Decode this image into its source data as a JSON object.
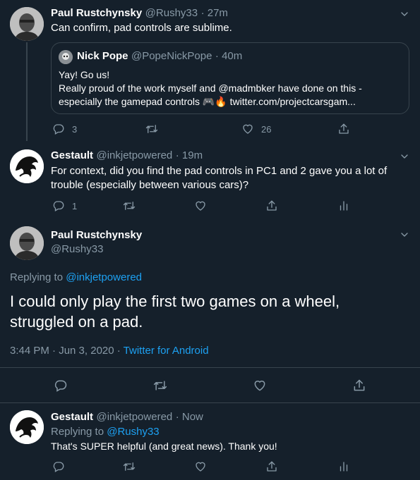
{
  "tweet1": {
    "name": "Paul Rustchynsky",
    "handle": "@Rushy33",
    "time": "· 27m",
    "text": "Can confirm, pad controls are sublime.",
    "quote": {
      "name": "Nick Pope",
      "handle": "@PopeNickPope",
      "time": "· 40m",
      "line1": "Yay! Go us!",
      "line2": "Really proud of the work myself and @madmbker have done on this -",
      "line3_pre": "especially the gamepad controls",
      "line3_emoji": "🎮🔥",
      "line3_link": "twitter.com/projectcarsgam..."
    },
    "reply_count": "3",
    "like_count": "26"
  },
  "tweet2": {
    "name": "Gestault",
    "handle": "@inkjetpowered",
    "time": "· 19m",
    "line1": "For context, did you find the pad controls in PC1 and 2 gave you a lot of",
    "line2": "trouble (especially between various cars)?",
    "reply_count": "1"
  },
  "main": {
    "name": "Paul Rustchynsky",
    "handle": "@Rushy33",
    "replying_prefix": "Replying to",
    "replying_to": "@inkjetpowered",
    "line1": "I could only play the first two games on a wheel,",
    "line2": "struggled on a pad.",
    "timestamp": "3:44 PM · Jun 3, 2020 ·",
    "client": "Twitter for Android"
  },
  "reply": {
    "name": "Gestault",
    "handle": "@inkjetpowered",
    "time": "· Now",
    "replying_prefix": "Replying to",
    "replying_to": "@Rushy33",
    "text": "That's SUPER helpful (and great news). Thank you!"
  }
}
